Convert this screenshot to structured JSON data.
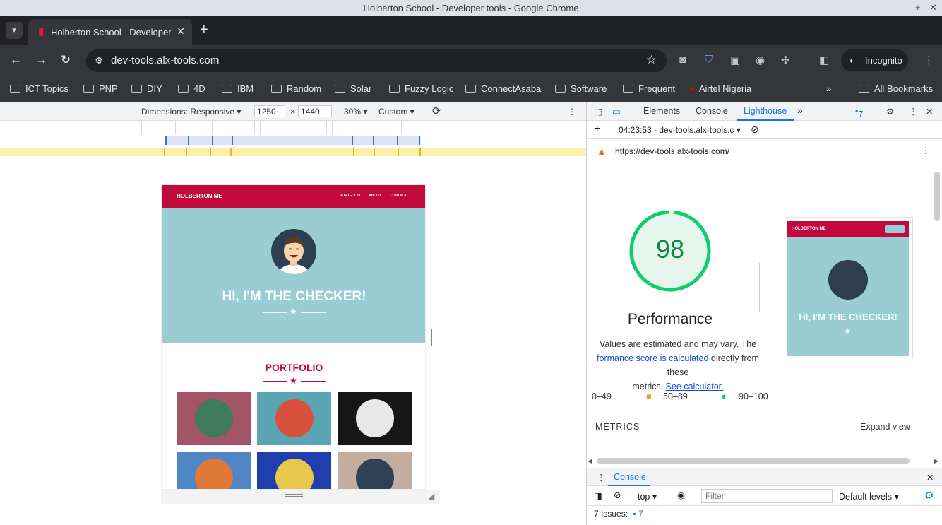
{
  "window": {
    "title": "Holberton School - Developer tools - Google Chrome"
  },
  "tab": {
    "label": "Holberton School - Developer"
  },
  "omnibox": {
    "url": "dev-tools.alx-tools.com"
  },
  "profile": {
    "label": "Incognito"
  },
  "bookmarks": {
    "items": [
      "ICT Topics",
      "PNP",
      "DIY",
      "4D",
      "IBM",
      "Random",
      "Solar",
      "Fuzzy Logic",
      "ConnectAsaba",
      "Software",
      "Frequent",
      "Airtel Nigeria"
    ],
    "overflow": "»",
    "all": "All Bookmarks"
  },
  "device_toolbar": {
    "dimensions": "Dimensions: Responsive",
    "width": "1250",
    "x": "×",
    "height": "1440",
    "zoom": "30%",
    "throttle": "Custom"
  },
  "site": {
    "brand": "HOLBERTON ME",
    "nav": [
      "PORTFOLIO",
      "ABOUT",
      "CONTACT"
    ],
    "hero_title": "HI, I'M THE CHECKER!",
    "portfolio_title": "PORTFOLIO",
    "tile_colors": [
      "#a35566",
      "#5ba4b4",
      "#171717",
      "#4f86c6",
      "#1f3faf",
      "#c4ad9f"
    ]
  },
  "devtools": {
    "tabs": [
      "Elements",
      "Console",
      "Lighthouse"
    ],
    "more": "»",
    "issues_count": "7",
    "report_time": "04:23:53 - dev-tools.alx-tools.c",
    "report_url": "https://dev-tools.alx-tools.com/"
  },
  "lighthouse": {
    "score": "98",
    "category": "Performance",
    "desc_1": "Values are estimated and may vary. The",
    "desc_link": "formance score is calculated",
    "desc_2": "directly from these",
    "desc_3": "metrics.",
    "desc_calc": "See calculator.",
    "legend": [
      "0–49",
      "50–89",
      "90–100"
    ],
    "metrics_label": "METRICS",
    "expand": "Expand view",
    "thumb_brand": "HOLBERTON ME",
    "thumb_title": "HI, I'M THE CHECKER!"
  },
  "console": {
    "tab": "Console",
    "context": "top",
    "filter_placeholder": "Filter",
    "levels": "Default levels",
    "issues_label": "7 Issues:",
    "issues_count": "7"
  },
  "colors": {
    "brand_red": "#c2093b",
    "hero_teal": "#99cdd3",
    "score_green": "#0cce6b",
    "link_blue": "#1a73e8"
  }
}
